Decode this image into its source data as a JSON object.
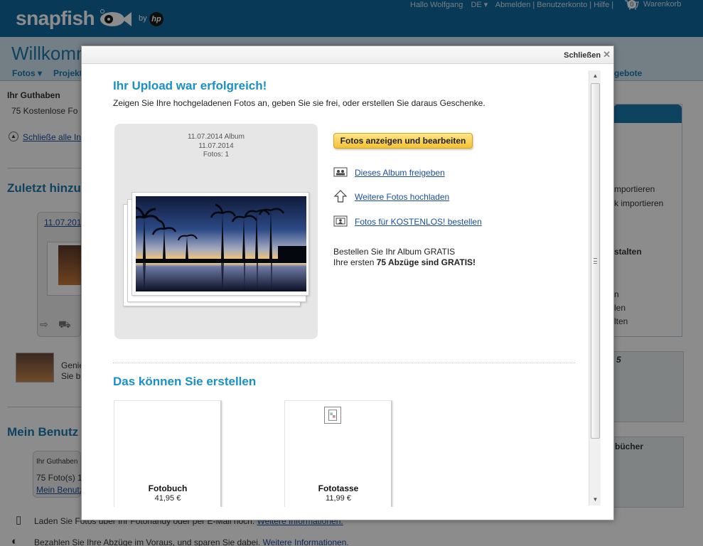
{
  "header": {
    "logo": "snapfish",
    "by": "by",
    "hp": "hp",
    "greeting": "Hallo Wolfgang",
    "language": "DE ▾",
    "account_links": "Abmelden | Benutzerkonto | Hilfe |",
    "cart_count": "0",
    "cart_label": "Warenkorb"
  },
  "background": {
    "welcome": "Willkomm",
    "nav": [
      "Fotos ▾",
      "Projekt",
      "gebote"
    ],
    "credit_title": "Ihr Guthaben",
    "credit_text": "75  Kostenlose Fo",
    "close_all": "Schließe alle In",
    "recent_heading": "Zuletzt hinzu",
    "recent_album_link": "11.07.201",
    "genie_line1": "Genie",
    "genie_line2": "Sie b",
    "account_heading": "Mein Benutz",
    "account_box_title": "Ihr Guthaben",
    "account_box_line": "75 Foto(s) 1",
    "account_box_link": "Mein Benutz",
    "footer_line1_text": "Laden Sie Fotos über Ihr Fotohandy oder per E-Mail hoch.",
    "footer_line1_link": "Weitere Informationen.",
    "footer_line2_text": "Bezahlen Sie Ihre Abzüge im Voraus, und sparen Sie dabei.",
    "footer_line2_link": "Weitere Informationen.",
    "right_items": [
      "mportieren",
      "k importieren",
      "stalten",
      "n",
      "len",
      "lten"
    ],
    "promo1": "5",
    "promo2": "bücher"
  },
  "modal": {
    "close_label": "Schließen",
    "title": "Ihr Upload war erfolgreich!",
    "subtitle": "Zeigen Sie Ihre hochgeladenen Fotos an, geben Sie sie frei, oder erstellen Sie daraus Geschenke.",
    "album": {
      "line1": "11.07.2014  Album",
      "line2": "11.07.2014",
      "line3": "Fotos: 1"
    },
    "primary_button": "Fotos anzeigen und bearbeiten",
    "actions": [
      {
        "label": "Dieses Album freigeben",
        "icon": "share-album-icon"
      },
      {
        "label": "Weitere Fotos hochladen",
        "icon": "upload-arrow-icon"
      },
      {
        "label": "Fotos für KOSTENLOS! bestellen",
        "icon": "order-photos-icon"
      }
    ],
    "promo_line1": "Bestellen Sie Ihr Album GRATIS",
    "promo_line2_prefix": "Ihre ersten ",
    "promo_line2_bold": "75 Abzüge sind GRATIS!",
    "create_heading": "Das können Sie erstellen",
    "products": [
      {
        "name": "Fotobuch",
        "price": "41,95 €"
      },
      {
        "name": "Fototasse",
        "price": "11,99 €"
      }
    ]
  },
  "colors": {
    "header_blue": "#0f6a9e",
    "accent_blue": "#1a8fc8",
    "link_blue": "#1a4fa0",
    "button_yellow": "#f5c233"
  }
}
